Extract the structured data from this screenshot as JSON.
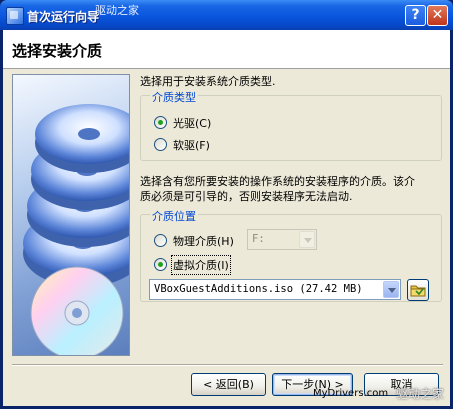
{
  "titlebar": {
    "title": "首次运行向导",
    "watermark": "驱动之家"
  },
  "header": {
    "title": "选择安装介质"
  },
  "type_section": {
    "description": "选择用于安装系统介质类型.",
    "legend": "介质类型",
    "options": [
      {
        "label": "光驱(C)",
        "checked": true
      },
      {
        "label": "软驱(F)",
        "checked": false
      }
    ]
  },
  "location_section": {
    "description_line1": "选择含有您所要安装的操作系统的安装程序的介质。该介",
    "description_line2": "质必须是可引导的，否则安装程序无法启动.",
    "legend": "介质位置",
    "physical_option": {
      "label": "物理介质(H)",
      "checked": false
    },
    "physical_drive_value": "F:",
    "virtual_option": {
      "label": "虚拟介质(I)",
      "checked": true
    },
    "virtual_media_value": "VBoxGuestAdditions.iso (27.42 MB)"
  },
  "buttons": {
    "back": "< 返回(B)",
    "next": "下一步(N) >",
    "cancel": "取消"
  },
  "watermark_bottom": {
    "site": "MyDrivers.com",
    "brand": "驱动之家"
  },
  "colors": {
    "titlebar": "#0a56de",
    "dialog_face": "#ece9d8",
    "legend_text": "#0046d5",
    "radio_checked": "#21a121"
  }
}
